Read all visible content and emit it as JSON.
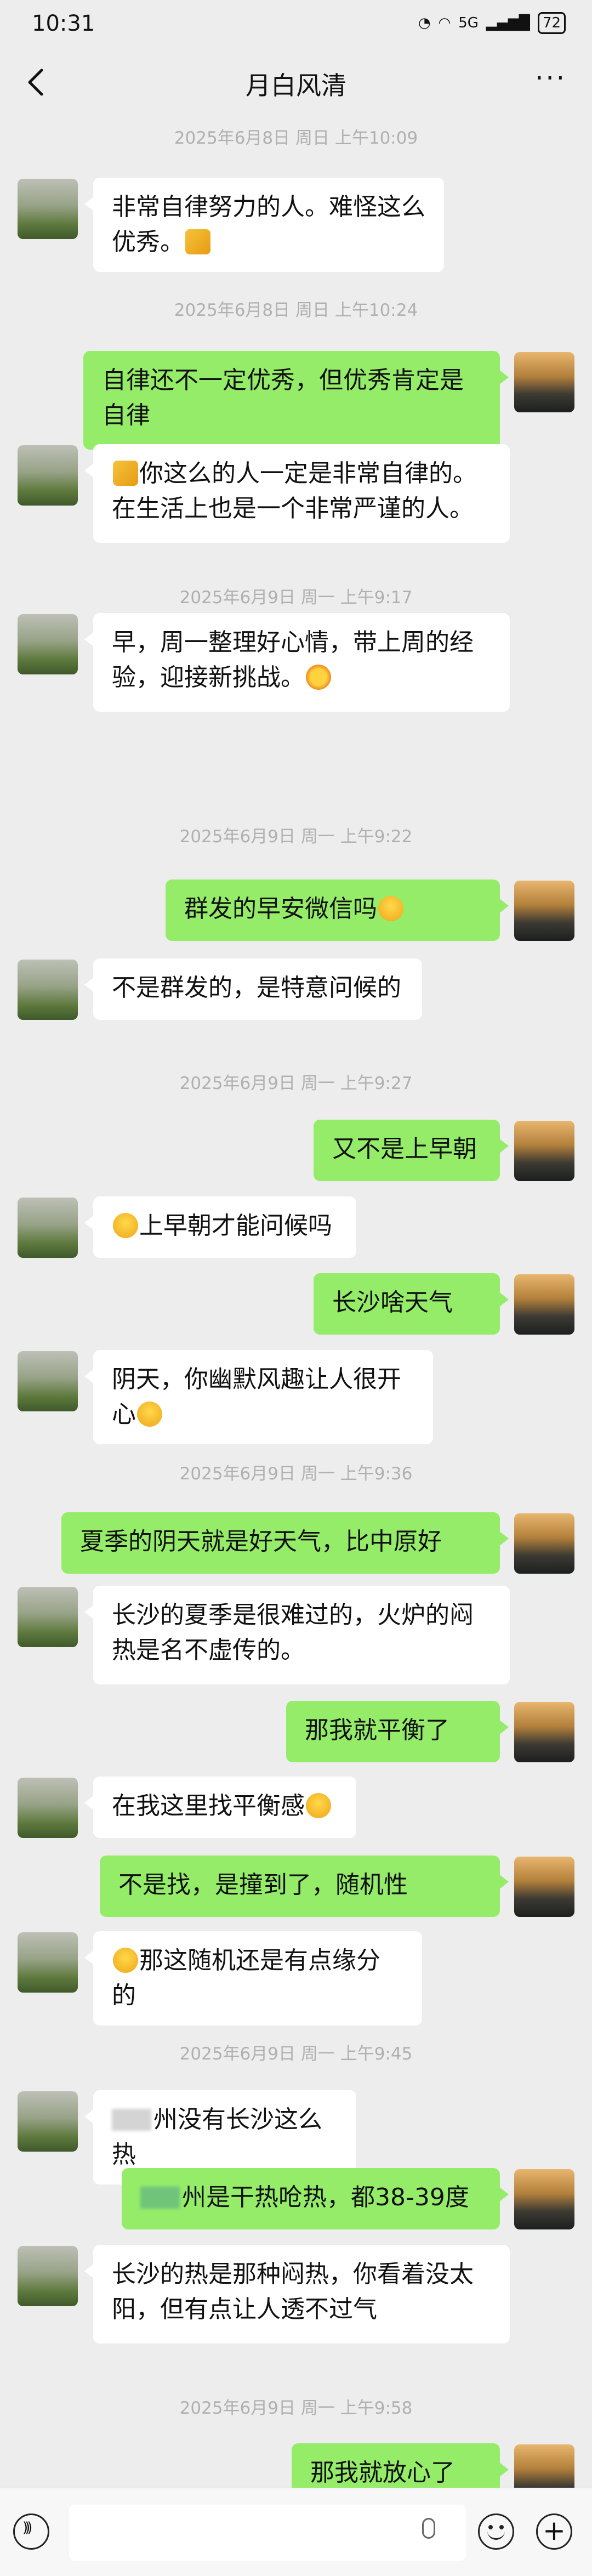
{
  "status": {
    "time": "10:31",
    "signal": "5G",
    "battery": "72"
  },
  "nav": {
    "title": "月白风清",
    "more": "···"
  },
  "messages": [
    {
      "type": "time",
      "text": "2025年6月8日 周日 上午10:09"
    },
    {
      "type": "in",
      "lines": [
        "非常自律努力的人。难怪这么优秀。"
      ],
      "emoji_end": "thumbs-up-icon"
    },
    {
      "type": "time",
      "text": "2025年6月8日 周日 上午10:24"
    },
    {
      "type": "out",
      "lines": [
        "自律还不一定优秀，但优秀肯定是",
        "自律"
      ]
    },
    {
      "type": "in",
      "lines": [
        "你这么的人一定是非常自律的。",
        "在生活上也是一个非常严谨的人。"
      ],
      "emoji_start": "thumbs-up-icon"
    },
    {
      "type": "time",
      "text": "2025年6月9日 周一 上午9:17"
    },
    {
      "type": "in",
      "lines": [
        "早，周一整理好心情，带上周的经",
        "验，迎接新挑战。"
      ],
      "emoji_end": "sun-icon"
    },
    {
      "type": "time",
      "text": "2025年6月9日 周一 上午9:22"
    },
    {
      "type": "out",
      "lines": [
        "群发的早安微信吗"
      ],
      "emoji_end": "grin-icon"
    },
    {
      "type": "in",
      "lines": [
        "不是群发的，是特意问候的"
      ]
    },
    {
      "type": "time",
      "text": "2025年6月9日 周一 上午9:27"
    },
    {
      "type": "out",
      "lines": [
        "又不是上早朝"
      ]
    },
    {
      "type": "in",
      "lines": [
        "上早朝才能问候吗"
      ],
      "emoji_start": "grin-icon"
    },
    {
      "type": "out",
      "lines": [
        "长沙啥天气"
      ]
    },
    {
      "type": "in",
      "lines": [
        "阴天，你幽默风趣让人很开心"
      ],
      "emoji_end": "wink-icon"
    },
    {
      "type": "time",
      "text": "2025年6月9日 周一 上午9:36"
    },
    {
      "type": "out",
      "lines": [
        "夏季的阴天就是好天气，比中原好"
      ]
    },
    {
      "type": "in",
      "lines": [
        "长沙的夏季是很难过的，火炉的闷",
        "热是名不虚传的。"
      ]
    },
    {
      "type": "out",
      "lines": [
        "那我就平衡了"
      ]
    },
    {
      "type": "in",
      "lines": [
        "在我这里找平衡感"
      ],
      "emoji_end": "sweat-icon"
    },
    {
      "type": "out",
      "lines": [
        "不是找，是撞到了，随机性"
      ]
    },
    {
      "type": "in",
      "lines": [
        "那这随机还是有点缘分的"
      ],
      "emoji_start": "thinking-icon"
    },
    {
      "type": "time",
      "text": "2025年6月9日 周一 上午9:45"
    },
    {
      "type": "in",
      "lines": [
        "州没有长沙这么热"
      ],
      "blur_start": true
    },
    {
      "type": "out",
      "lines": [
        "州是干热呛热，都38-39度"
      ],
      "blur_start": true
    },
    {
      "type": "in",
      "lines": [
        "长沙的热是那种闷热，你看着没太",
        "阳，但有点让人透不过气"
      ]
    },
    {
      "type": "time",
      "text": "2025年6月9日 周一 上午9:58"
    },
    {
      "type": "out",
      "lines": [
        "那我就放心了"
      ]
    }
  ]
}
